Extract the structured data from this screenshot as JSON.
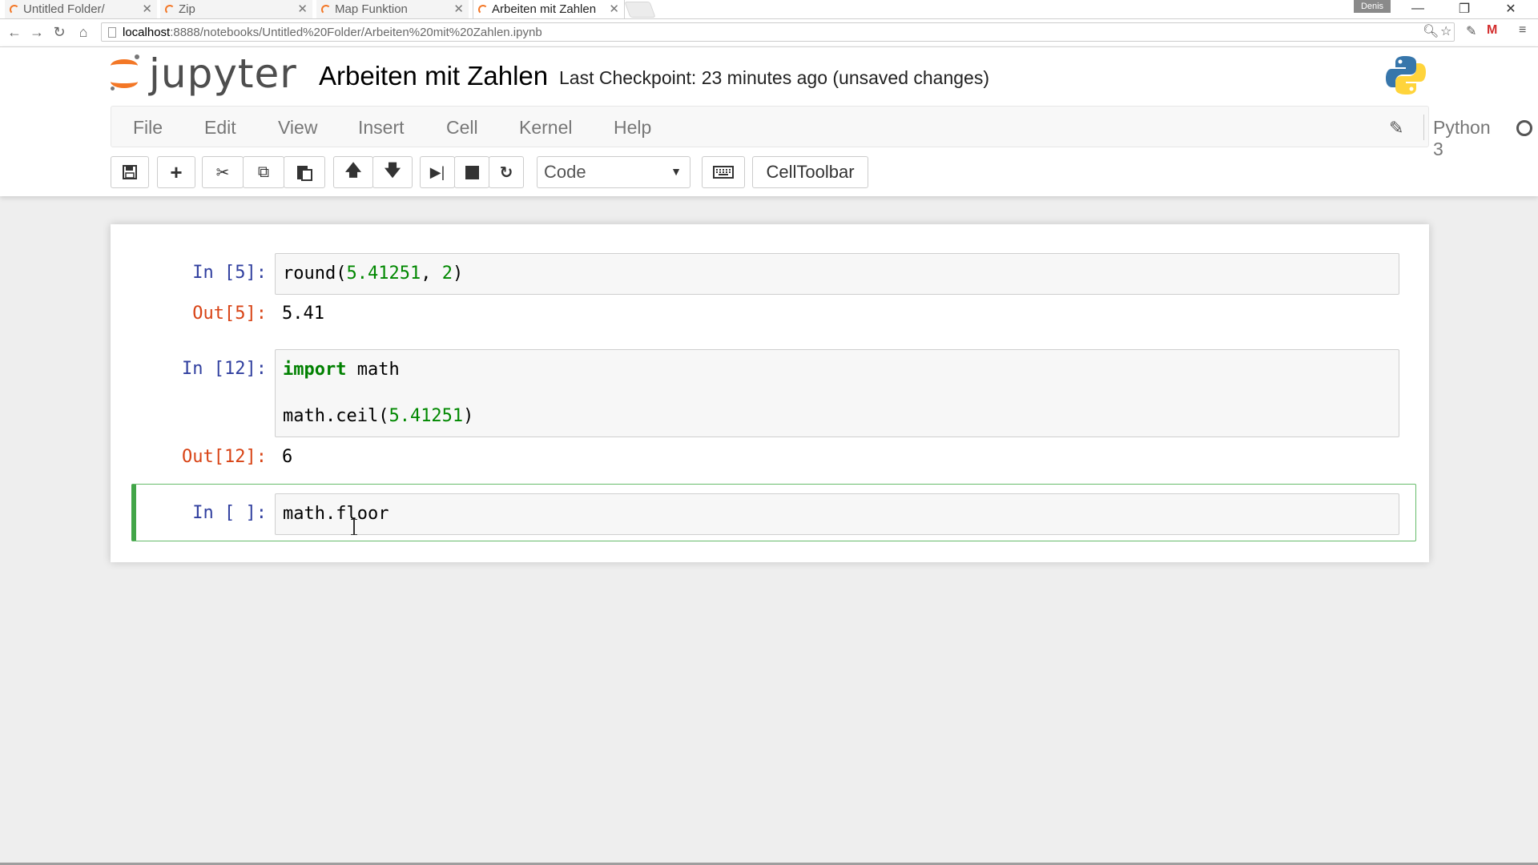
{
  "browser": {
    "tabs": [
      {
        "label": "Untitled Folder/",
        "active": false
      },
      {
        "label": "Zip",
        "active": false
      },
      {
        "label": "Map Funktion",
        "active": false
      },
      {
        "label": "Arbeiten mit Zahlen",
        "active": true
      }
    ],
    "profile_label": "Denis",
    "url_host": "localhost",
    "url_path": ":8888/notebooks/Untitled%20Folder/Arbeiten%20mit%20Zahlen.ipynb",
    "icons": {
      "back": "arrow-left-icon",
      "forward": "arrow-right-icon",
      "reload": "reload-icon",
      "home": "home-icon",
      "zoom": "zoom-icon",
      "bookmark": "star-icon",
      "extension": "extension-icon",
      "gmail": "gmail-icon",
      "menu": "hamburger-menu-icon"
    }
  },
  "header": {
    "logo_text": "jupyter",
    "notebook_title": "Arbeiten mit Zahlen",
    "checkpoint": "Last Checkpoint: 23 minutes ago (unsaved changes)",
    "brand_color": "#f37726"
  },
  "menubar": {
    "items": [
      "File",
      "Edit",
      "View",
      "Insert",
      "Cell",
      "Kernel",
      "Help"
    ],
    "kernel_name": "Python 3"
  },
  "toolbar": {
    "cell_type": "Code",
    "celltoolbar_label": "CellToolbar",
    "icons": [
      "save-icon",
      "plus-icon",
      "cut-icon",
      "copy-icon",
      "paste-icon",
      "arrow-up-icon",
      "arrow-down-icon",
      "run-icon",
      "stop-icon",
      "restart-icon",
      "keyboard-icon"
    ]
  },
  "cells": [
    {
      "in_prompt": "In [5]:",
      "code_fn": "round(",
      "code_arg1": "5.41251",
      "code_sep": ", ",
      "code_arg2": "2",
      "code_close": ")",
      "out_prompt": "Out[5]:",
      "output": "5.41"
    },
    {
      "in_prompt": "In [12]:",
      "code_kw": "import",
      "code_rest": " math",
      "code_line2_fn": "math.ceil(",
      "code_line2_arg": "5.41251",
      "code_line2_close": ")",
      "out_prompt": "Out[12]:",
      "output": "6"
    },
    {
      "in_prompt": "In [ ]:",
      "code": "math.floor"
    }
  ]
}
